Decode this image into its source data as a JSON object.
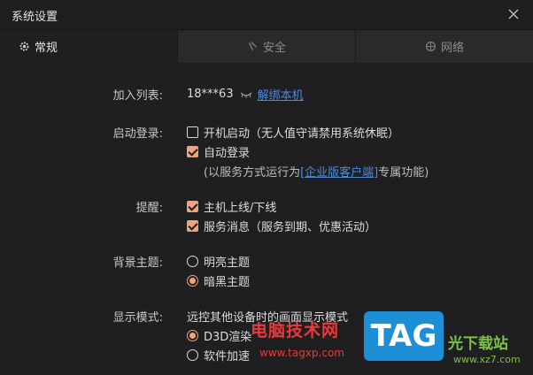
{
  "window": {
    "title": "系统设置"
  },
  "tabs": [
    {
      "label": "常规",
      "icon": "gear-icon",
      "active": true
    },
    {
      "label": "安全",
      "icon": "shield-icon",
      "active": false
    },
    {
      "label": "网络",
      "icon": "globe-icon",
      "active": false
    }
  ],
  "join_list": {
    "label": "加入列表:",
    "value": "18***63",
    "unbind_link": "解绑本机"
  },
  "startup": {
    "label": "启动登录:",
    "boot_start": {
      "text": "开机启动（无人值守请禁用系统休眠）",
      "checked": false
    },
    "auto_login": {
      "text": "自动登录",
      "checked": true
    },
    "note_prefix": "(以服务方式运行为",
    "note_link": "[企业版客户端]",
    "note_suffix": "专属功能)"
  },
  "reminder": {
    "label": "提醒:",
    "online_offline": {
      "text": "主机上线/下线",
      "checked": true
    },
    "service_msg": {
      "text": "服务消息（服务到期、优惠活动）",
      "checked": true
    }
  },
  "theme": {
    "label": "背景主题:",
    "options": [
      {
        "text": "明亮主题",
        "selected": false
      },
      {
        "text": "暗黑主题",
        "selected": true
      }
    ]
  },
  "display": {
    "label": "显示模式:",
    "desc": "远控其他设备时的画面显示模式",
    "options": [
      {
        "text": "D3D渲染",
        "selected": true
      },
      {
        "text": "软件加速",
        "selected": false
      }
    ]
  },
  "watermark": {
    "text": "电脑技术网",
    "url": "www.tagxp.com",
    "logo": "TAG",
    "site": "光下载站",
    "site_url": "www.xz7.com"
  },
  "colors": {
    "accent": "#f3a37c",
    "link": "#4f8bd8",
    "bg": "#1f1f21",
    "tabbar": "#2a2a2c"
  }
}
